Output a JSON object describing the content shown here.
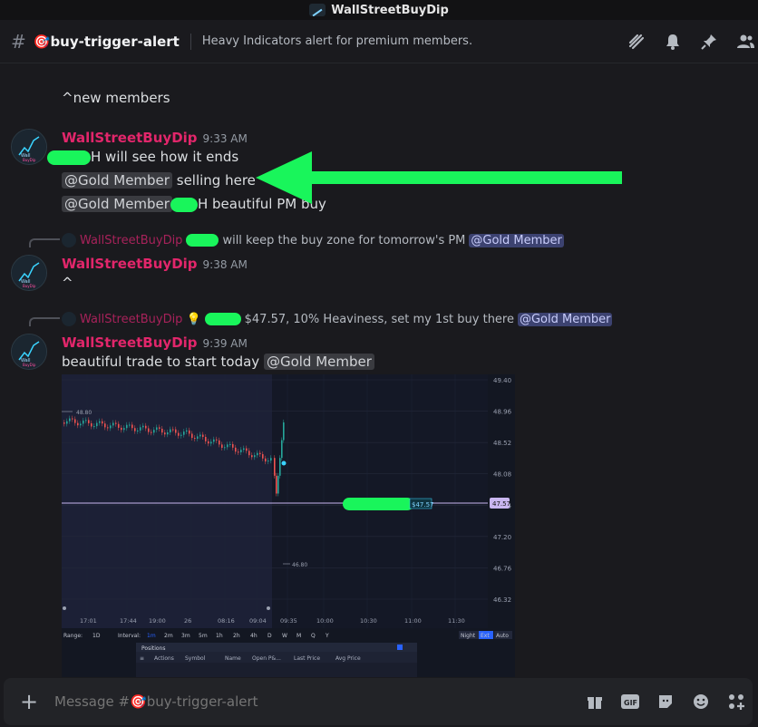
{
  "window": {
    "title": "WallStreetBuyDip"
  },
  "channel": {
    "name": "🎯buy-trigger-alert",
    "topic": "Heavy Indicators alert for premium members."
  },
  "messages": {
    "prev_text": "^new members",
    "m1": {
      "author": "WallStreetBuyDip",
      "time": "9:33 AM",
      "line1": "H will see how it ends",
      "mention": "@Gold Member",
      "line2": "selling here",
      "line3": "H beautiful PM buy"
    },
    "r1": {
      "author": "WallStreetBuyDip",
      "text": "will keep the buy zone for tomorrow's PM",
      "mention": "@Gold Member"
    },
    "m2": {
      "author": "WallStreetBuyDip",
      "time": "9:38 AM",
      "text": "^"
    },
    "r2": {
      "author": "WallStreetBuyDip",
      "emoji": "💡",
      "text": "$47.57, 10% Heaviness, set my 1st buy there",
      "mention": "@Gold Member"
    },
    "m3": {
      "author": "WallStreetBuyDip",
      "time": "9:39 AM",
      "text": "beautiful trade to start today",
      "mention": "@Gold Member"
    }
  },
  "chart_data": {
    "type": "line",
    "y_ticks": [
      "49.40",
      "48.96",
      "48.52",
      "48.08",
      "47.64",
      "47.20",
      "46.76",
      "46.32"
    ],
    "x_ticks": [
      "17:01",
      "17:44",
      "19:00",
      "26",
      "08:16",
      "09:04",
      "09:35",
      "10:00",
      "10:30",
      "11:00",
      "11:30"
    ],
    "annotations": {
      "high_label": "48.80",
      "low_label": "46.80",
      "order_price": "$47.57",
      "price_tag": "47.57"
    },
    "toolbar": {
      "range_label": "Range:",
      "range_value": "1D",
      "interval_label": "Interval:",
      "intervals": [
        "1m",
        "2m",
        "3m",
        "5m",
        "1h",
        "2h",
        "4h",
        "D",
        "W",
        "M",
        "Q",
        "Y"
      ],
      "night": "Night",
      "ext": "Ext",
      "auto": "Auto"
    },
    "positions": {
      "tab": "Positions",
      "columns": [
        "Actions",
        "Symbol",
        "Name",
        "Open P&...",
        "Last Price",
        "Avg Price"
      ]
    }
  },
  "composer": {
    "placeholder": "Message #🎯buy-trigger-alert"
  },
  "colors": {
    "accent_author": "#e2266b",
    "redaction": "#19f55b",
    "mention_bg": "#3c4270"
  }
}
